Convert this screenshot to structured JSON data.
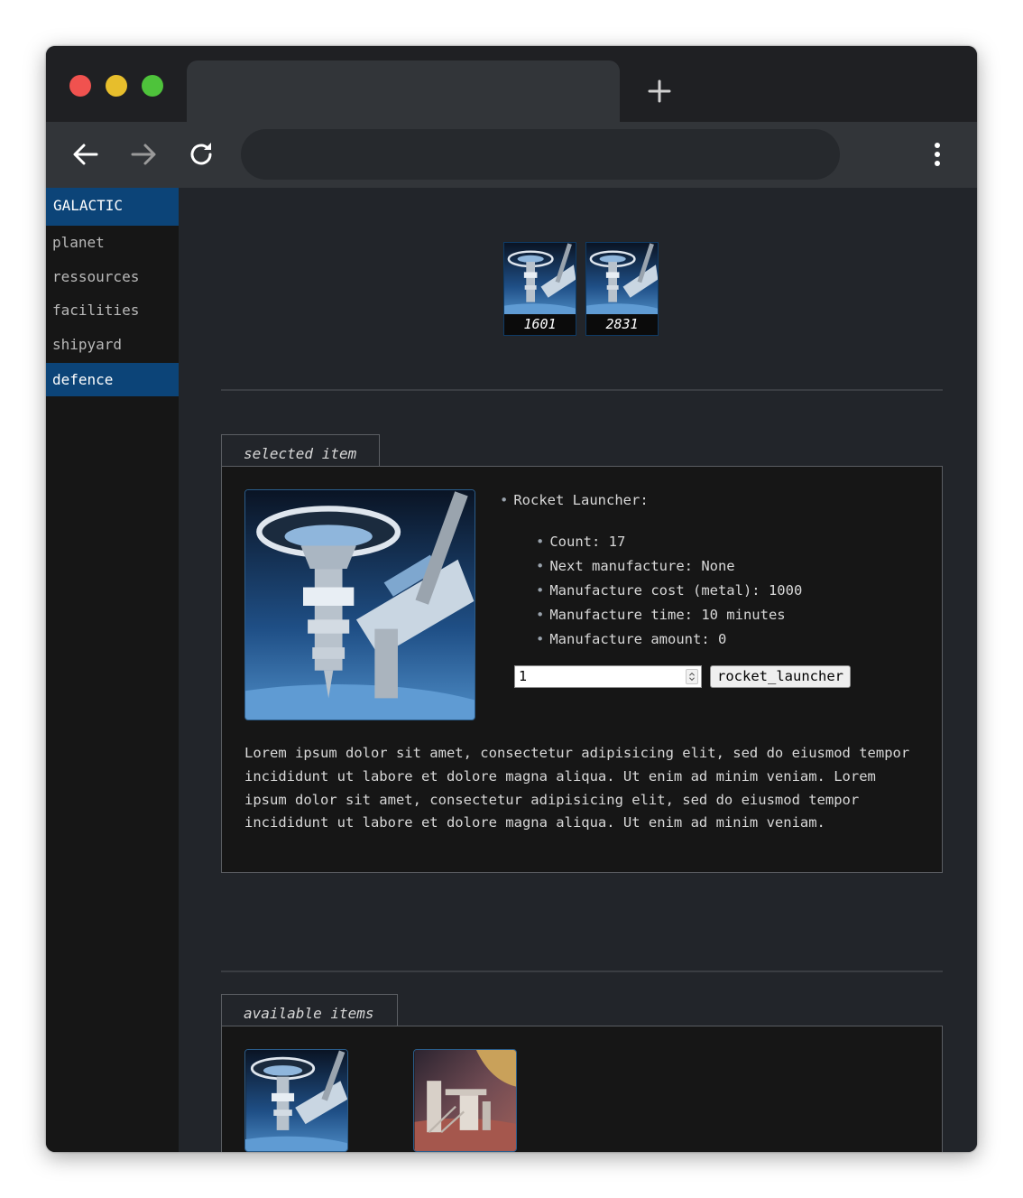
{
  "browser": {
    "traffic_lights": [
      "#f0524f",
      "#e7be2c",
      "#4ec33b"
    ]
  },
  "sidebar": {
    "brand": "GALACTIC",
    "items": [
      {
        "label": "planet"
      },
      {
        "label": "ressources"
      },
      {
        "label": "facilities"
      },
      {
        "label": "shipyard"
      },
      {
        "label": "defence",
        "active": true
      }
    ]
  },
  "resources": [
    {
      "icon": "space-station-image",
      "value": "1601"
    },
    {
      "icon": "space-station-image",
      "value": "2831"
    }
  ],
  "selected": {
    "legend": "selected item",
    "name": "Rocket Launcher:",
    "details": [
      "Count: 17",
      "Next manufacture: None",
      "Manufacture cost (metal): 1000",
      "Manufacture time: 10 minutes",
      "Manufacture amount: 0"
    ],
    "quantity": "1",
    "button": "rocket_launcher",
    "description": "Lorem ipsum dolor sit amet, consectetur adipisicing elit, sed do eiusmod tempor incididunt ut labore et dolore magna aliqua. Ut enim ad minim veniam. Lorem ipsum dolor sit amet, consectetur adipisicing elit, sed do eiusmod tempor incididunt ut labore et dolore magna aliqua. Ut enim ad minim veniam."
  },
  "available": {
    "legend": "available items",
    "items": [
      {
        "image": "space-station-image"
      },
      {
        "image": "mars-outpost-image"
      }
    ]
  },
  "colors": {
    "accent": "#0c4478",
    "panel": "#161616",
    "background": "#22252a"
  }
}
